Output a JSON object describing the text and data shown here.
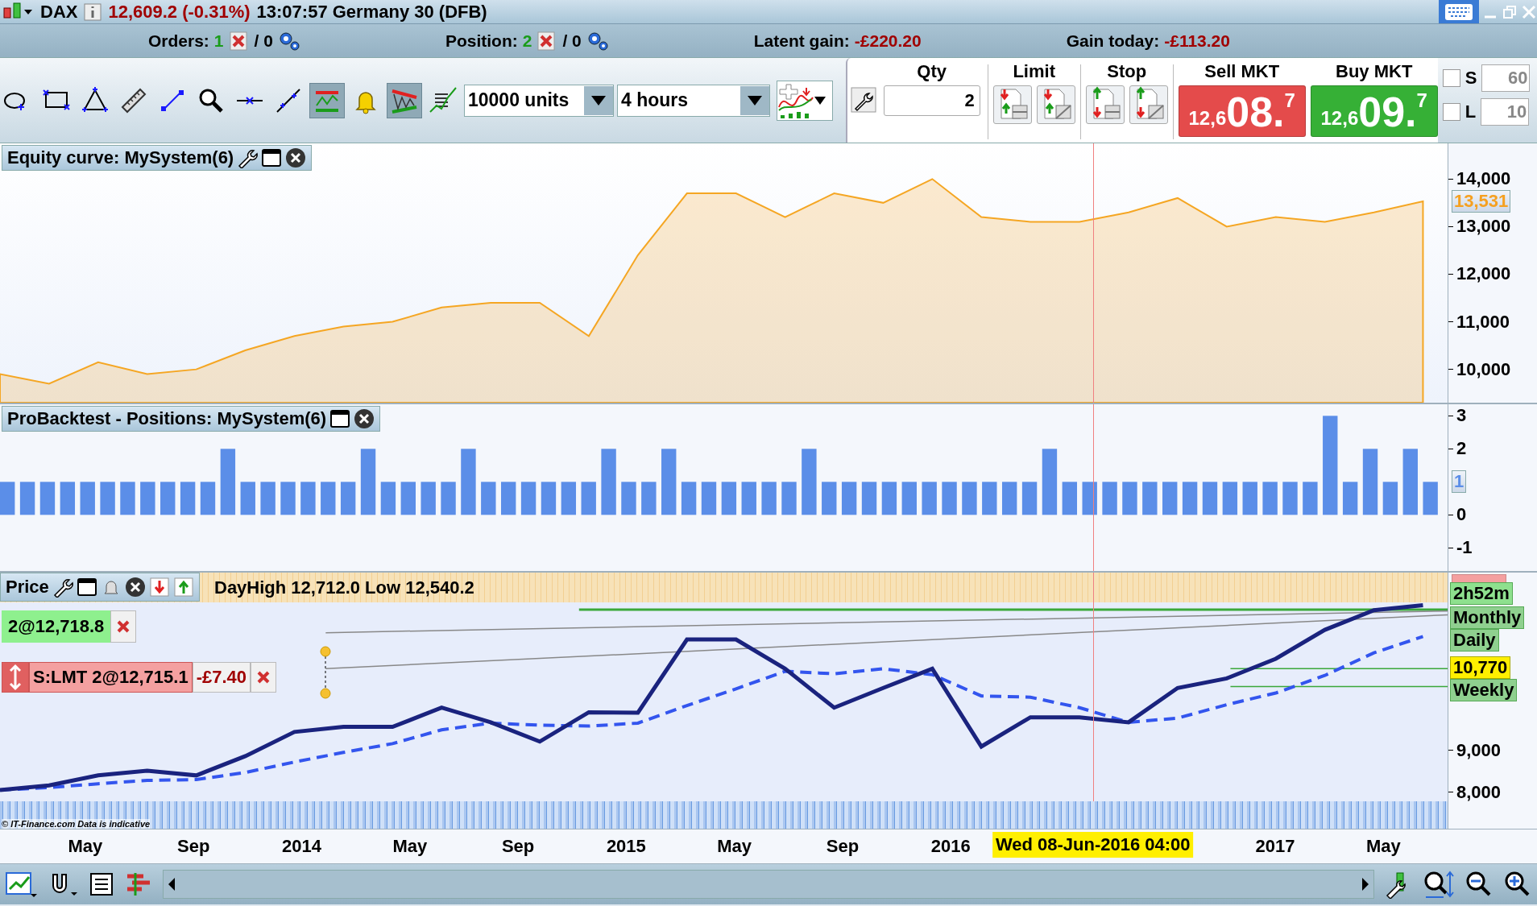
{
  "title_bar": {
    "instrument": "DAX",
    "price": "12,609.2 (-0.31%)",
    "time_and_name": "13:07:57 Germany 30 (DFB)"
  },
  "summary": {
    "orders_label": "Orders:",
    "orders_count": "1",
    "orders_pending": "/ 0",
    "position_label": "Position:",
    "position_count": "2",
    "position_pending": "/ 0",
    "latent_gain_label": "Latent gain:",
    "latent_gain": "-£220.20",
    "gain_today_label": "Gain today:",
    "gain_today": "-£113.20"
  },
  "tools": [
    {
      "kind": "ellipse",
      "selected": false
    },
    {
      "kind": "rectangle",
      "selected": false
    },
    {
      "kind": "triangle",
      "selected": false
    },
    {
      "kind": "ruler",
      "selected": false
    },
    {
      "kind": "segment",
      "selected": false
    },
    {
      "kind": "zoom",
      "selected": false
    },
    {
      "kind": "hline",
      "selected": false
    },
    {
      "kind": "line",
      "selected": false
    },
    {
      "kind": "channel",
      "selected": true
    },
    {
      "kind": "bell",
      "selected": false
    },
    {
      "kind": "wedge",
      "selected": true
    },
    {
      "kind": "lines",
      "selected": false
    }
  ],
  "units": {
    "value": "10000 units"
  },
  "timeframe": {
    "value": "4 hours"
  },
  "order_ticket": {
    "qty_label": "Qty",
    "qty": "2",
    "limit_label": "Limit",
    "stop_label": "Stop",
    "sell": {
      "label": "Sell MKT",
      "prefix": "12,6",
      "big": "08.",
      "sup": "7"
    },
    "buy": {
      "label": "Buy MKT",
      "prefix": "12,6",
      "big": "09.",
      "sup": "7"
    },
    "options": [
      {
        "label": "S",
        "checked": false,
        "placeholder": "60"
      },
      {
        "label": "L",
        "checked": false,
        "placeholder": "10"
      }
    ]
  },
  "equity_panel": {
    "title": "Equity curve: MySystem(6)",
    "current_label": "13,531",
    "chart_data": {
      "type": "area",
      "ylim": [
        9300,
        14750
      ],
      "yticks": [
        {
          "value": 10000,
          "label": "10,000"
        },
        {
          "value": 11000,
          "label": "11,000"
        },
        {
          "value": 12000,
          "label": "12,000"
        },
        {
          "value": 13000,
          "label": "13,000"
        },
        {
          "value": 14000,
          "label": "14,000"
        }
      ],
      "series": [
        {
          "color": "#f5a623",
          "values": [
            9900,
            9700,
            10150,
            9900,
            10000,
            10400,
            10700,
            10900,
            11000,
            11300,
            11400,
            11400,
            10700,
            12400,
            13700,
            13700,
            13200,
            13700,
            13500,
            14000,
            13200,
            13100,
            13100,
            13300,
            13600,
            13000,
            13200,
            13100,
            13300,
            13531
          ]
        }
      ]
    }
  },
  "positions_panel": {
    "title": "ProBacktest - Positions: MySystem(6)",
    "current_label": "1",
    "chart_data": {
      "type": "bar",
      "ylim": [
        -1.7,
        3.35
      ],
      "yticks": [
        {
          "value": -1,
          "label": "-1"
        },
        {
          "value": 0,
          "label": "0"
        },
        {
          "value": 2,
          "label": "2"
        },
        {
          "value": 3,
          "label": "3"
        }
      ],
      "series": [
        {
          "color": "#5b8ee8",
          "values": [
            1,
            1,
            1,
            1,
            1,
            1,
            1,
            1,
            1,
            1,
            1,
            2,
            1,
            1,
            1,
            1,
            1,
            1,
            2,
            1,
            1,
            1,
            1,
            2,
            1,
            1,
            1,
            1,
            1,
            1,
            2,
            1,
            1,
            2,
            1,
            1,
            1,
            1,
            1,
            1,
            2,
            1,
            1,
            1,
            1,
            1,
            1,
            1,
            1,
            1,
            1,
            1,
            2,
            1,
            1,
            1,
            1,
            1,
            1,
            1,
            1,
            1,
            1,
            1,
            1,
            1,
            3,
            1,
            2,
            1,
            2,
            1
          ]
        }
      ]
    }
  },
  "price_panel": {
    "title": "Price",
    "day_range": "DayHigh 12,712.0 Low 12,540.2",
    "position_order": "2@12,718.8",
    "limit_order": {
      "text": "S:LMT 2@12,715.1",
      "pnl": "-£7.40"
    },
    "axis_labels": [
      {
        "kind": "timer",
        "text": "2h52m"
      },
      {
        "kind": "level",
        "text": "Monthly"
      },
      {
        "kind": "level",
        "text": "Daily"
      },
      {
        "kind": "price",
        "text": "10,770"
      },
      {
        "kind": "level",
        "text": "Weekly"
      }
    ],
    "copyright": "© IT-Finance.com Data is indicative",
    "chart_data": {
      "type": "line",
      "ylim": [
        7126,
        12537
      ],
      "yticks": [
        {
          "value": 8000,
          "label": "8,000"
        },
        {
          "value": 9000,
          "label": "9,000"
        }
      ],
      "series": [
        {
          "color": "#1a237e",
          "values": [
            8050,
            8160,
            8400,
            8510,
            8400,
            8860,
            9440,
            9560,
            9560,
            10020,
            9670,
            9210,
            9910,
            9900,
            11650,
            11650,
            10950,
            10020,
            10490,
            10950,
            9090,
            9790,
            9790,
            9670,
            10490,
            10720,
            11190,
            11880,
            12350,
            12470
          ]
        },
        {
          "color": "#3355ee",
          "line_style": "dashed",
          "values": [
            8050,
            8110,
            8200,
            8280,
            8300,
            8470,
            8720,
            8950,
            9160,
            9490,
            9650,
            9600,
            9580,
            9650,
            10070,
            10470,
            10890,
            10830,
            10950,
            10810,
            10300,
            10270,
            10020,
            9670,
            9770,
            10090,
            10370,
            10790,
            11330,
            11720
          ]
        }
      ]
    }
  },
  "time_axis": {
    "labels": [
      "May",
      "Sep",
      "2014",
      "May",
      "Sep",
      "2015",
      "May",
      "Sep",
      "2016",
      "2017",
      "May"
    ],
    "cursor": "Wed 08-Jun-2016 04:00"
  }
}
